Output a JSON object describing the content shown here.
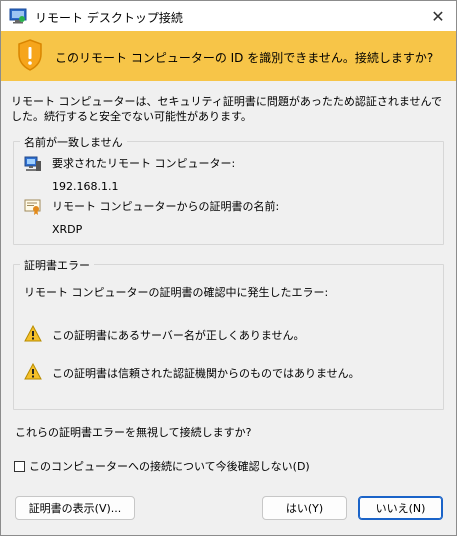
{
  "window": {
    "title": "リモート デスクトップ接続"
  },
  "banner": {
    "heading": "このリモート コンピューターの ID を識別できません。接続しますか?"
  },
  "intro": "リモート コンピューターは、セキュリティ証明書に問題があったため認証されませんでした。続行すると安全でない可能性があります。",
  "name_mismatch": {
    "legend": "名前が一致しません",
    "requested_label": "要求されたリモート コンピューター:",
    "requested_value": "192.168.1.1",
    "cert_name_label": "リモート コンピューターからの証明書の名前:",
    "cert_name_value": "XRDP"
  },
  "cert_errors": {
    "legend": "証明書エラー",
    "intro": "リモート コンピューターの証明書の確認中に発生したエラー:",
    "items": [
      "この証明書にあるサーバー名が正しくありません。",
      "この証明書は信頼された認証機関からのものではありません。"
    ]
  },
  "question": "これらの証明書エラーを無視して接続しますか?",
  "checkbox": {
    "label": "このコンピューターへの接続について今後確認しない(D)",
    "checked": false
  },
  "buttons": {
    "view_cert": "証明書の表示(V)...",
    "yes": "はい(Y)",
    "no": "いいえ(N)"
  },
  "colors": {
    "banner": "#f7c548",
    "accent": "#1a63c8"
  },
  "icons": {
    "app": "remote-desktop-icon",
    "banner": "warning-shield-icon",
    "requested": "computer-icon",
    "cert": "certificate-icon",
    "error": "warning-triangle-icon",
    "close": "close-icon"
  }
}
